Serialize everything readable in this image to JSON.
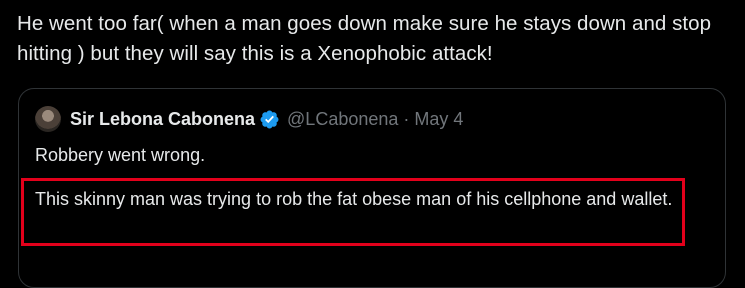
{
  "tweet": {
    "text": "He went too far( when a man goes down make sure he stays down and stop hitting ) but they will say this is a Xenophobic attack!"
  },
  "quoted_tweet": {
    "author_name": "Sir Lebona Cabonena",
    "handle": "@LCabonena",
    "separator": "·",
    "date": "May 4",
    "text_line1": "Robbery went wrong.",
    "text_highlighted": "This skinny man was trying to rob the fat obese man of his cellphone and wallet."
  },
  "colors": {
    "background": "#000000",
    "text": "#e7e9ea",
    "muted": "#71767b",
    "verified": "#1d9bf0",
    "highlight_border": "#e3001b"
  },
  "icons": {
    "verified": "verified-badge-icon"
  }
}
